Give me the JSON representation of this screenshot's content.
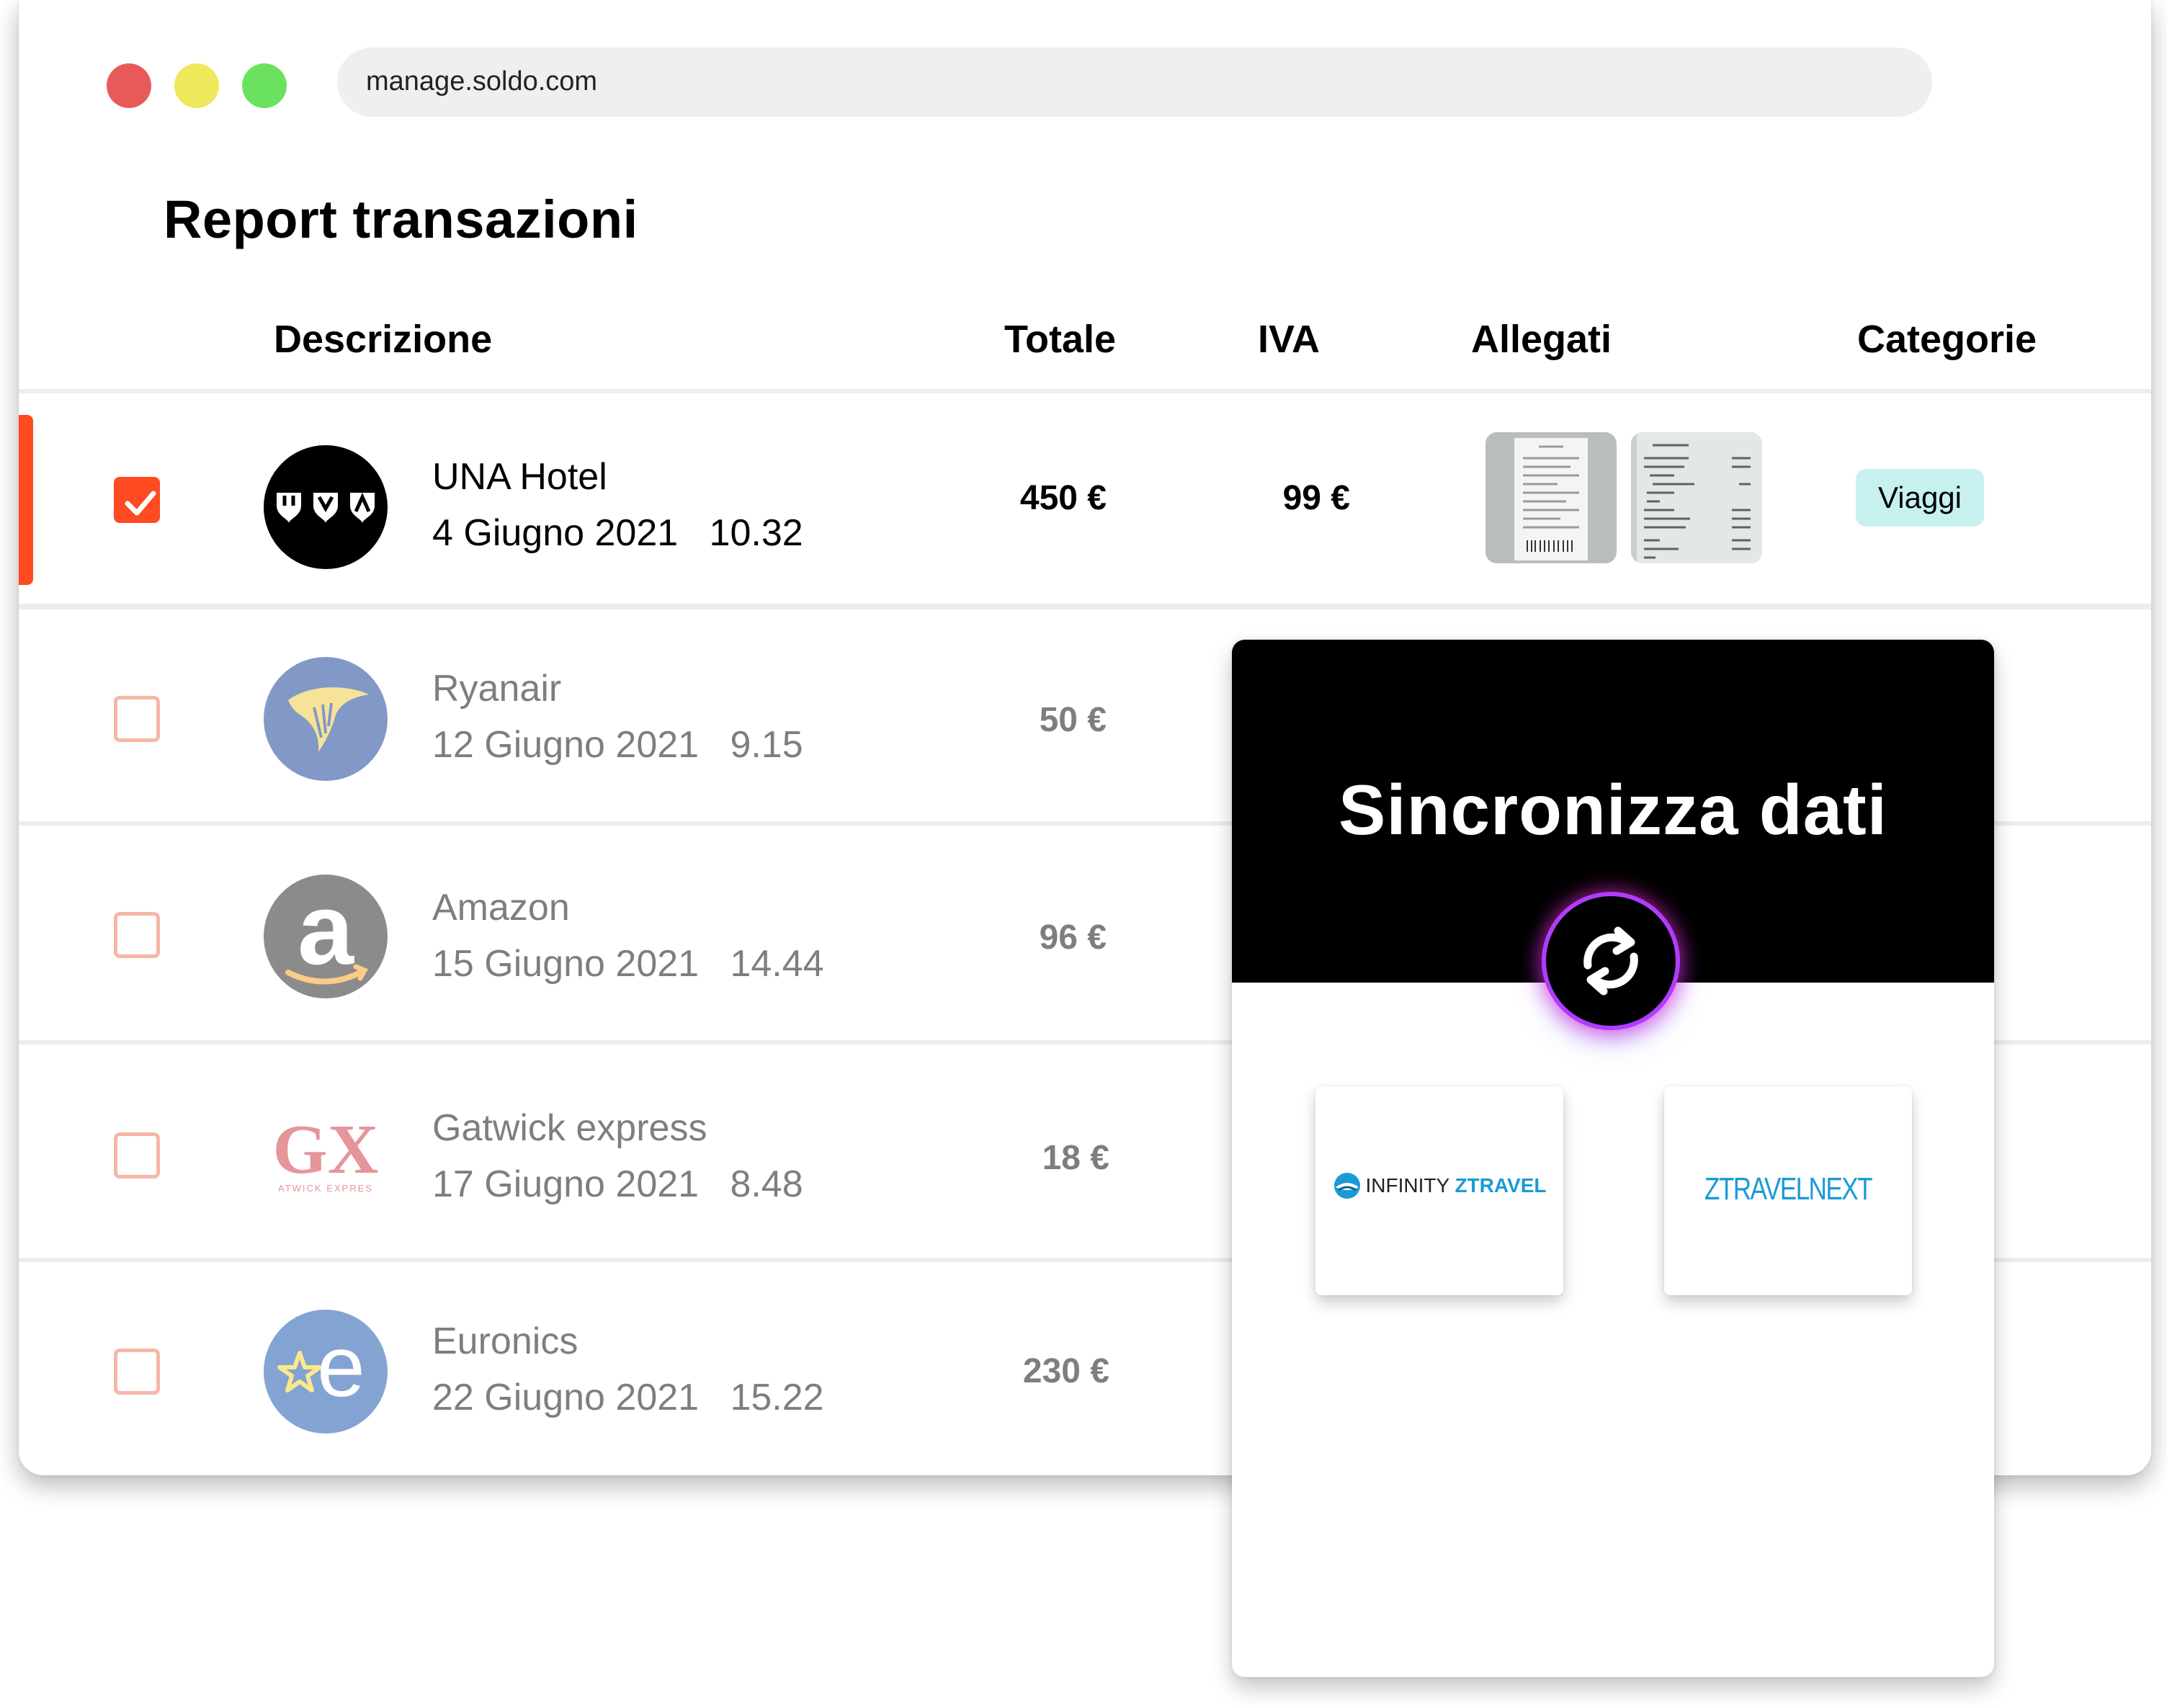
{
  "browser": {
    "url": "manage.soldo.com"
  },
  "page": {
    "title": "Report transazioni"
  },
  "table": {
    "headers": {
      "description": "Descrizione",
      "total": "Totale",
      "vat": "IVA",
      "attachments": "Allegati",
      "categories": "Categorie"
    },
    "rows": [
      {
        "name": "UNA Hotel",
        "date": "4 Giugno 2021",
        "time": "10.32",
        "total": "450 €",
        "vat": "99 €",
        "category": "Viaggi",
        "checked": true,
        "logo": "una-hotel-logo"
      },
      {
        "name": "Ryanair",
        "date": "12 Giugno 2021",
        "time": "9.15",
        "total": "50 €",
        "checked": false,
        "logo": "ryanair-logo"
      },
      {
        "name": "Amazon",
        "date": "15 Giugno 2021",
        "time": "14.44",
        "total": "96 €",
        "checked": false,
        "logo": "amazon-logo"
      },
      {
        "name": "Gatwick express",
        "date": "17 Giugno 2021",
        "time": "8.48",
        "total": "18 €",
        "checked": false,
        "logo": "gatwick-express-logo"
      },
      {
        "name": "Euronics",
        "date": "22 Giugno 2021",
        "time": "15.22",
        "total": "230 €",
        "checked": false,
        "logo": "euronics-logo"
      }
    ]
  },
  "sync_panel": {
    "title": "Sincronizza dati",
    "integrations": [
      {
        "name_part1": "INFINITY ",
        "name_part2": "ZTRAVEL"
      },
      {
        "name_part1": "ZTRAVEL",
        "name_part2": "NEXT"
      }
    ]
  },
  "logos": {
    "gatwick_text": "GX",
    "gatwick_sub": "ATWICK EXPRES",
    "amazon_letter": "a",
    "euronics_letter": "e"
  },
  "colors": {
    "accent": "#ff4a22",
    "category_badge": "#c7f1ef",
    "ztravel_blue": "#1a9ad6"
  }
}
